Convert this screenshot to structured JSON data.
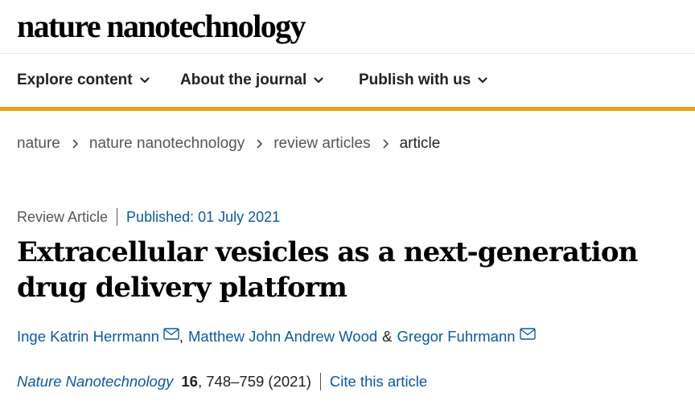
{
  "site": {
    "logo_text": "nature nanotechnology"
  },
  "nav": {
    "items": [
      {
        "label": "Explore content"
      },
      {
        "label": "About the journal"
      },
      {
        "label": "Publish with us"
      }
    ],
    "accent_color": "#e8a215"
  },
  "breadcrumb": {
    "items": [
      {
        "label": "nature"
      },
      {
        "label": "nature nanotechnology"
      },
      {
        "label": "review articles"
      },
      {
        "label": "article"
      }
    ]
  },
  "article": {
    "type": "Review Article",
    "published": "Published: 01 July 2021",
    "title": "Extracellular vesicles as a next-generation drug delivery platform",
    "authors": [
      {
        "name": "Inge Katrin Herrmann",
        "has_email": true
      },
      {
        "name": "Matthew John Andrew Wood",
        "has_email": false
      },
      {
        "name": "Gregor Fuhrmann",
        "has_email": true
      }
    ],
    "separators": {
      "comma": ",",
      "ampersand": "&"
    },
    "citation": {
      "journal": "Nature Nanotechnology",
      "volume": "16",
      "pages_year": ", 748–759 (2021)",
      "cite_label": "Cite this article"
    },
    "link_color": "#0b5aa2",
    "icons": [
      "chevron-down-icon",
      "chevron-right-icon",
      "envelope-icon"
    ]
  }
}
